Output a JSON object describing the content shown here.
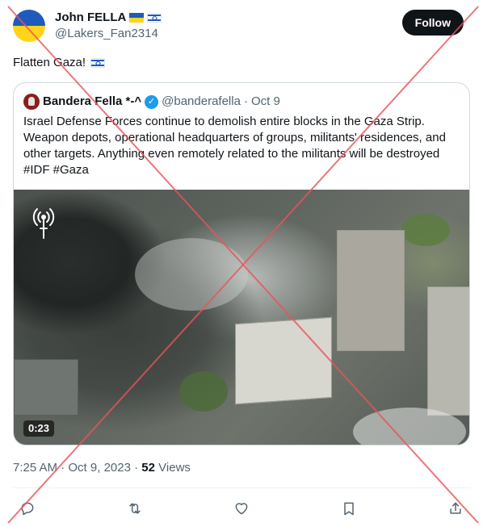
{
  "header": {
    "display_name": "John FELLA",
    "handle": "@Lakers_Fan2314",
    "follow_label": "Follow"
  },
  "tweet": {
    "text": "Flatten Gaza!"
  },
  "quote": {
    "name": "Bandera Fella *-^",
    "handle": "@banderafella",
    "separator": "·",
    "date": "Oct 9",
    "body": "Israel Defense Forces continue to demolish entire blocks in the Gaza Strip. Weapon depots, operational headquarters of groups, militants' residences, and other targets. Anything even remotely related to the militants will be destroyed #IDF #Gaza",
    "video_duration": "0:23"
  },
  "meta": {
    "time": "7:25 AM",
    "separator": "·",
    "date": "Oct 9, 2023",
    "separator2": "·",
    "views_count": "52",
    "views_label": "Views"
  },
  "icons": {
    "reply": "reply-icon",
    "retweet": "retweet-icon",
    "like": "heart-icon",
    "bookmark": "bookmark-icon",
    "share": "share-icon"
  },
  "colors": {
    "follow_bg": "#0f1419",
    "verified": "#1d9bf0",
    "overlay_cross": "#e8545b"
  }
}
